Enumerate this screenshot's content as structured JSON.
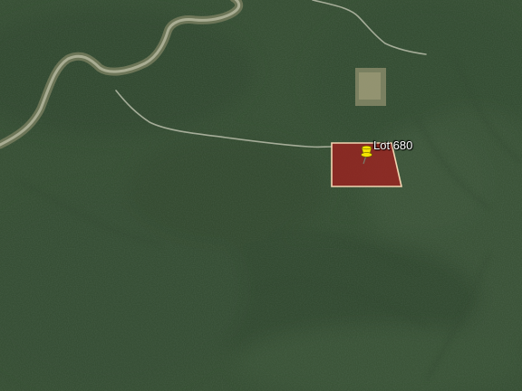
{
  "map": {
    "view": "satellite",
    "parcel": {
      "label": "Lot 680",
      "fill_color": "#a31e1e",
      "outline_color": "#f2d6b3",
      "marker_icon": "pushpin-icon",
      "marker_color": "#f5e400"
    },
    "features": [
      "river",
      "dirt-road",
      "clearing",
      "forest"
    ]
  }
}
